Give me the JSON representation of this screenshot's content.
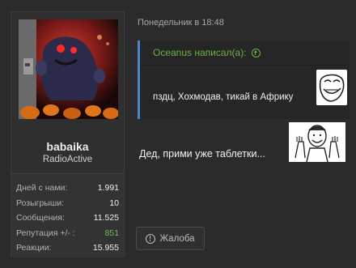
{
  "user": {
    "name": "babaika",
    "title": "RadioActive",
    "avatar_icon": "halloween-monster-avatar",
    "stats": [
      {
        "label": "Дней с нами:",
        "value": "1.991"
      },
      {
        "label": "Розыгрыши:",
        "value": "10"
      },
      {
        "label": "Сообщения:",
        "value": "11.525"
      },
      {
        "label": "Репутация +/- :",
        "value": "851",
        "positive": true
      },
      {
        "label": "Реакции:",
        "value": "15.955"
      }
    ]
  },
  "post": {
    "date": "Понедельник в 18:48",
    "quote": {
      "author": "Oceanus написал(а):",
      "text": "пздц, Хохмодав, тикай в Африку",
      "accent_color": "#4a87c9",
      "author_color": "#6fb046"
    },
    "text": "Дед, прими уже таблетки...",
    "report_label": "Жалоба"
  }
}
